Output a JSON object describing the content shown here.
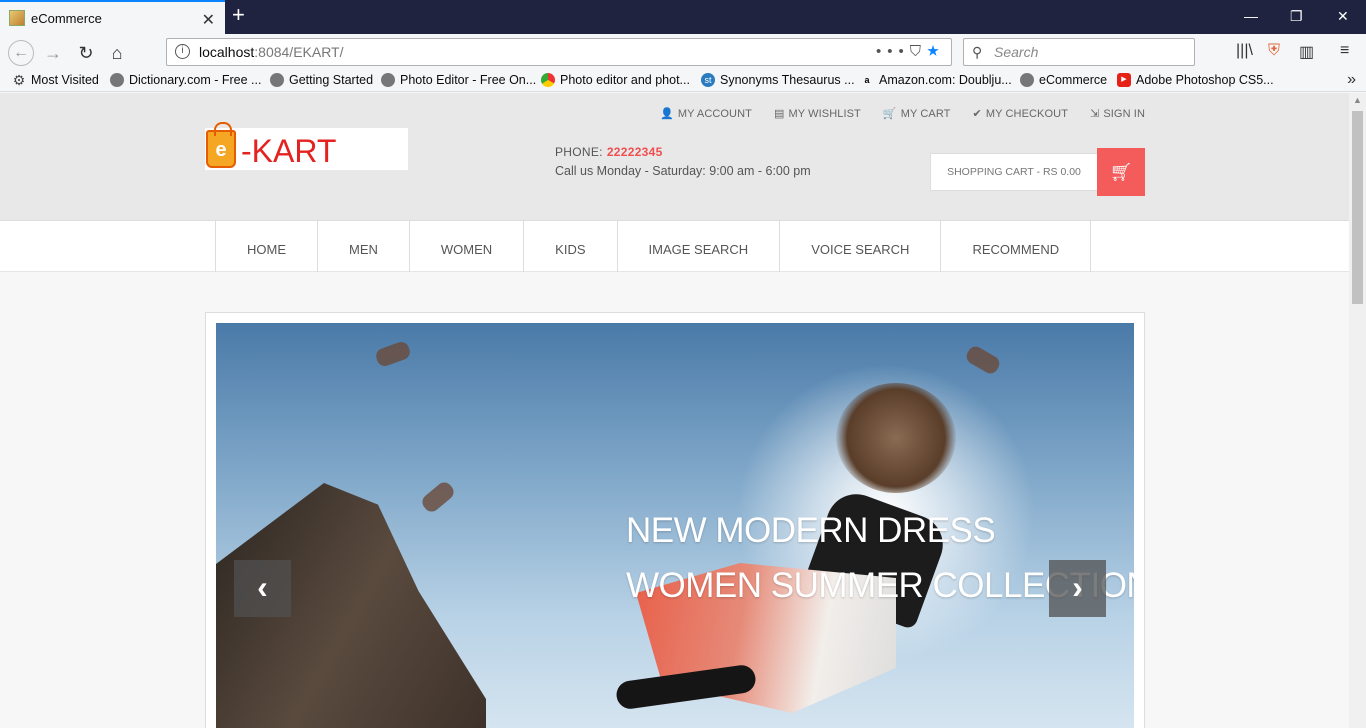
{
  "browser": {
    "tab_title": "eCommerce",
    "url_prefix": "localhost",
    "url_rest": ":8084/EKART/",
    "search_placeholder": "Search",
    "bookmarks": [
      {
        "label": "Most Visited"
      },
      {
        "label": "Dictionary.com - Free ..."
      },
      {
        "label": "Getting Started"
      },
      {
        "label": "Photo Editor - Free On..."
      },
      {
        "label": "Photo editor and phot..."
      },
      {
        "label": "Synonyms Thesaurus ..."
      },
      {
        "label": "Amazon.com: Doublju..."
      },
      {
        "label": "eCommerce"
      },
      {
        "label": "Adobe Photoshop CS5..."
      }
    ]
  },
  "header": {
    "top_links": [
      {
        "label": "MY ACCOUNT",
        "icon": "user-icon"
      },
      {
        "label": "MY WISHLIST",
        "icon": "wishlist-icon"
      },
      {
        "label": "MY CART",
        "icon": "cart-icon"
      },
      {
        "label": "MY CHECKOUT",
        "icon": "check-icon"
      },
      {
        "label": "SIGN IN",
        "icon": "sign-in-icon"
      }
    ],
    "logo_letter": "e",
    "logo_text": "-KART",
    "phone_label": "PHONE:",
    "phone_number": "22222345",
    "hours": "Call us Monday - Saturday: 9:00 am - 6:00 pm",
    "cart_label": "SHOPPING CART - RS 0.00"
  },
  "menu": [
    {
      "label": "HOME"
    },
    {
      "label": "MEN"
    },
    {
      "label": "WOMEN"
    },
    {
      "label": "KIDS"
    },
    {
      "label": "IMAGE SEARCH"
    },
    {
      "label": "VOICE SEARCH"
    },
    {
      "label": "RECOMMEND"
    }
  ],
  "slider": {
    "line1": "NEW MODERN DRESS",
    "line2": "WOMEN SUMMER COLLECTION",
    "prev": "‹",
    "next": "›"
  },
  "colors": {
    "accent": "#f45b5b",
    "logo_red": "#e52222",
    "tab_bar": "#202340"
  }
}
